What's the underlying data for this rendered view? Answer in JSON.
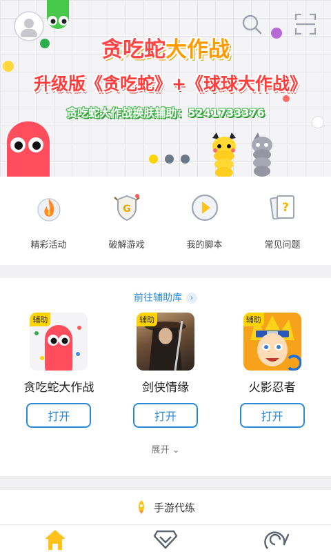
{
  "banner": {
    "title_part1": "贪吃蛇",
    "title_part2": "大作战",
    "subtitle": "升级版《贪吃蛇》+《球球大作战》",
    "helper_line": "贪吃蛇大作战换肤辅助：5241733376",
    "icons": [
      "avatar",
      "search-icon",
      "scan-icon"
    ],
    "pager_count": 3,
    "pager_active": 0
  },
  "quick_menu": [
    {
      "label": "精彩活动",
      "icon": "flame-icon"
    },
    {
      "label": "破解游戏",
      "icon": "shield-g-icon"
    },
    {
      "label": "我的脚本",
      "icon": "play-icon"
    },
    {
      "label": "常见问题",
      "icon": "question-card-icon"
    }
  ],
  "assist": {
    "header": "前往辅助库",
    "header_chevron": "›",
    "badge": "辅助",
    "apps": [
      {
        "name": "贪吃蛇大作战",
        "button": "打开"
      },
      {
        "name": "剑侠情缘",
        "button": "打开"
      },
      {
        "name": "火影忍者",
        "button": "打开"
      }
    ],
    "expand_label": "展开 ⌄"
  },
  "service": {
    "label": "手游代练",
    "icon": "rocket-icon"
  },
  "tabbar": [
    {
      "icon": "home-icon",
      "active": true
    },
    {
      "icon": "diamond-icon",
      "active": false
    },
    {
      "icon": "leaf-village-icon",
      "active": false
    }
  ],
  "colors": {
    "accent_blue": "#2b88d8",
    "brand_yellow": "#ffd400",
    "title_red": "#ff4545",
    "helper_green": "#44b84a"
  }
}
